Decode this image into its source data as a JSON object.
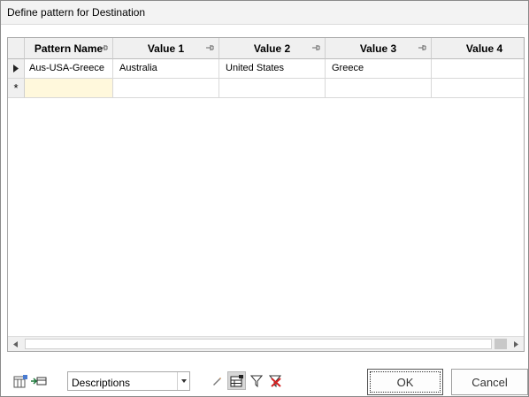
{
  "window": {
    "title": "Define pattern for Destination"
  },
  "grid": {
    "columns": [
      "Pattern Name",
      "Value 1",
      "Value 2",
      "Value 3",
      "Value 4"
    ],
    "rows": [
      {
        "pattern_name": "Aus-USA-Greece",
        "value1": "Australia",
        "value2": "United States",
        "value3": "Greece",
        "value4": ""
      }
    ],
    "new_row_marker": "*"
  },
  "toolbar": {
    "display_mode": {
      "selected": "Descriptions"
    },
    "icons": [
      "column-chooser-icon",
      "insert-row-icon",
      "edit-icon",
      "grid-layout-icon",
      "filter-icon",
      "clear-filter-icon"
    ]
  },
  "buttons": {
    "ok_label": "OK",
    "cancel_label": "Cancel"
  }
}
